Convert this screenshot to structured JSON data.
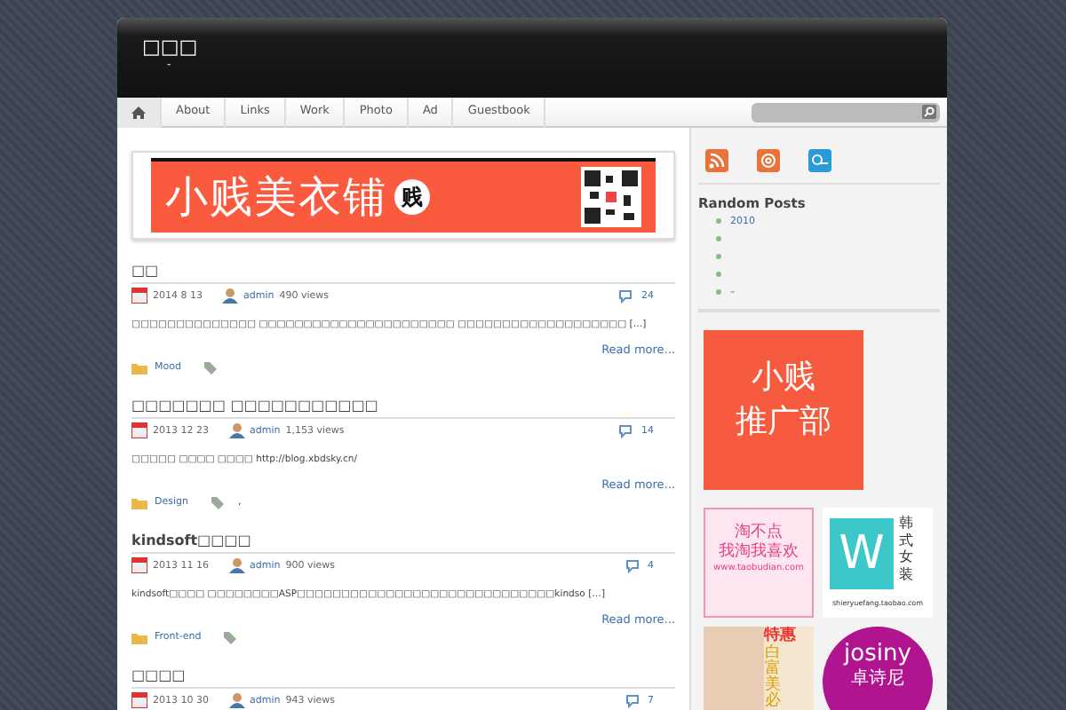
{
  "site": {
    "title": "□□□",
    "tagline": "-"
  },
  "nav": {
    "items": [
      {
        "label": "About"
      },
      {
        "label": "Links"
      },
      {
        "label": "Work"
      },
      {
        "label": "Photo"
      },
      {
        "label": "Ad"
      },
      {
        "label": "Guestbook"
      }
    ]
  },
  "banner": {
    "text": "小贱美衣铺",
    "badge": "贱"
  },
  "posts": [
    {
      "title": "□□",
      "date": "2014 8 13",
      "author": "admin",
      "views": "490 views",
      "comments": "24",
      "excerpt": "□□□□□□□□□□□□□□ □□□□□□□□□□□□□□□□□□□□□□ □□□□□□□□□□□□□□□□□□□ […]",
      "read_more": "Read more...",
      "category": "Mood"
    },
    {
      "title": "□□□□□□□ □□□□□□□□□□□",
      "date": "2013 12 23",
      "author": "admin",
      "views": "1,153 views",
      "comments": "14",
      "excerpt": "□□□□□ □□□□ □□□□ http://blog.xbdsky.cn/",
      "read_more": "Read more...",
      "category": "Design",
      "tags": ","
    },
    {
      "title": "kindsoft□□□□",
      "date": "2013 11 16",
      "author": "admin",
      "views": "900 views",
      "comments": "4",
      "excerpt": "kindsoft□□□□ □□□□□□□□ASP□□□□□□□□□□□□□□□□□□□□□□□□□□□□□kindso […]",
      "read_more": "Read more...",
      "category": "Front-end"
    },
    {
      "title": "□□□□",
      "date": "2013 10 30",
      "author": "admin",
      "views": "943 views",
      "comments": "7"
    }
  ],
  "sidebar": {
    "random_posts": {
      "title": "Random Posts",
      "items": [
        {
          "kind": "link",
          "text": "2010"
        },
        {
          "kind": "blank"
        },
        {
          "kind": "blank"
        },
        {
          "kind": "blank"
        },
        {
          "kind": "link",
          "text": "–"
        }
      ]
    },
    "promo": {
      "line_1": "小贱",
      "line_2": "推广部"
    },
    "ads": [
      {
        "kind": "text",
        "lines": [
          "淘不点",
          "我淘我喜欢",
          "www.taobudian.com"
        ]
      },
      {
        "kind": "logo",
        "mark": "W",
        "side": "韩式女装",
        "caption": "shieryuefang.taobao.com"
      },
      {
        "kind": "photo",
        "lines": [
          "特惠",
          "白富美必"
        ]
      },
      {
        "kind": "circle",
        "lines": [
          "josiny",
          "卓诗尼"
        ]
      }
    ]
  }
}
